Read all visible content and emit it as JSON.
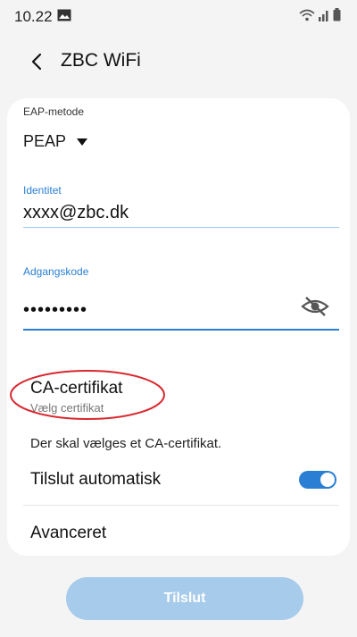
{
  "status_bar": {
    "time": "10.22"
  },
  "header": {
    "title": "ZBC WiFi"
  },
  "form": {
    "eap_label": "EAP-metode",
    "eap_value": "PEAP",
    "identity_label": "Identitet",
    "identity_value": "xxxx@zbc.dk",
    "password_label": "Adgangskode",
    "password_value": "•••••••••",
    "ca_title": "CA-certifikat",
    "ca_subtitle": "Vælg certifikat",
    "ca_warning": "Der skal vælges et CA-certifikat.",
    "auto_connect_label": "Tilslut automatisk",
    "auto_connect_on": true,
    "advanced_label": "Avanceret"
  },
  "connect_label": "Tilslut",
  "colors": {
    "accent": "#2a7fd4",
    "annotation": "#d9272e",
    "button_disabled": "#a7cbea"
  },
  "icons": {
    "back": "back-arrow-icon",
    "dropdown": "dropdown-arrow-icon",
    "password_toggle": "eye-slash-icon",
    "status_gallery": "gallery-icon",
    "status_wifi": "wifi-icon",
    "status_signal": "signal-icon",
    "status_battery": "battery-icon"
  }
}
